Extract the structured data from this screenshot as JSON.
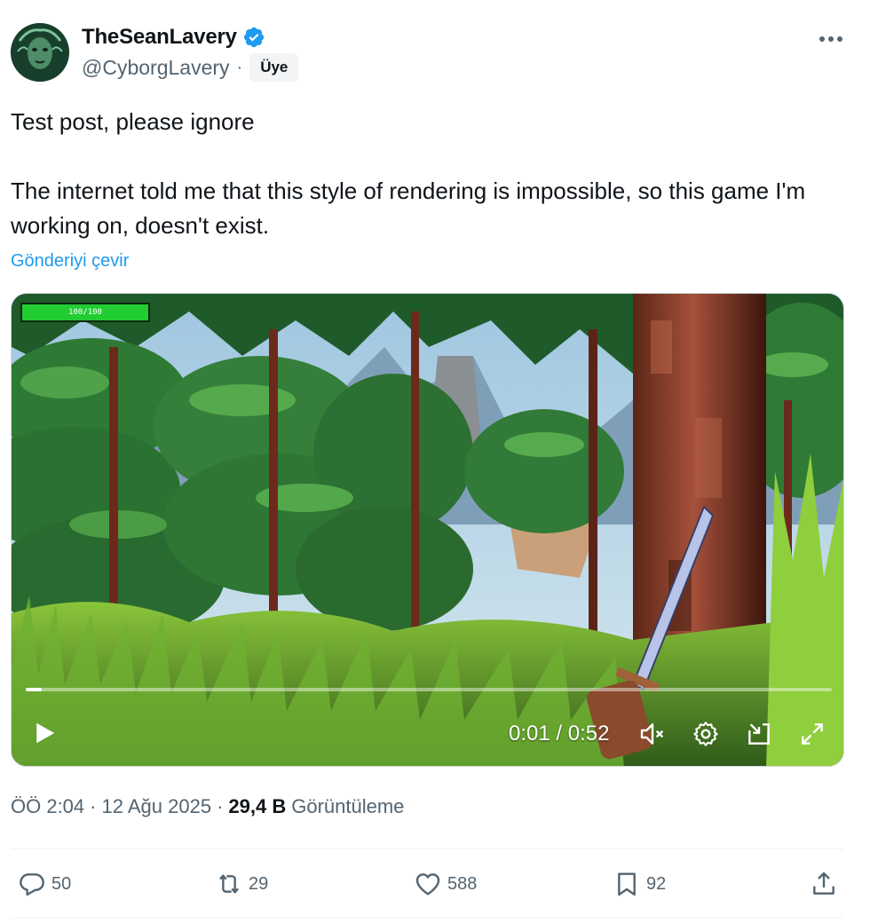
{
  "author": {
    "display_name": "TheSeanLavery",
    "handle": "@CyborgLavery",
    "separator": "·",
    "badge": "Üye",
    "verified": true
  },
  "post": {
    "line1": "Test post, please ignore",
    "line2": "The internet told me that this style of rendering is impossible, so this game I'm working on, doesn't exist.",
    "translate_label": "Gönderiyi çevir"
  },
  "video": {
    "hud_health": "100/100",
    "time": "0:01 / 0:52",
    "progress": 0.02,
    "muted": true
  },
  "meta": {
    "time": "ÖÖ 2:04",
    "sep1": "·",
    "date": "12 Ağu 2025",
    "sep2": "·",
    "views_count": "29,4 B",
    "views_label": "Görüntüleme"
  },
  "actions": {
    "replies": "50",
    "reposts": "29",
    "likes": "588",
    "bookmarks": "92"
  },
  "colors": {
    "accent": "#1d9bf0",
    "text": "#0f1419",
    "muted": "#536471"
  }
}
